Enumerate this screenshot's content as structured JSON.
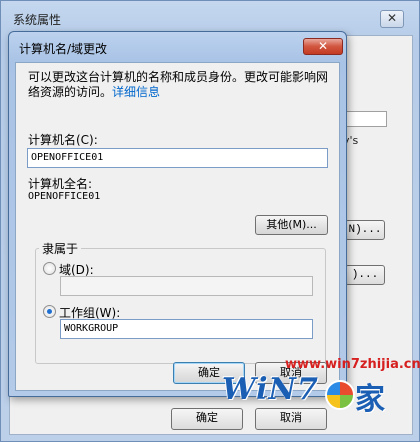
{
  "background_window": {
    "title": "系统属性",
    "close_glyph": "✕",
    "partial_text": "y's",
    "button_network": "N)...",
    "button_change": ")...",
    "ok_label": "确定",
    "cancel_label": "取消"
  },
  "dialog": {
    "title": "计算机名/域更改",
    "close_glyph": "✕",
    "description": "可以更改这台计算机的名称和成员身份。更改可能影响网络资源的访问。",
    "details_link": "详细信息",
    "computer_name_label": "计算机名(C):",
    "computer_name_value": "OPENOFFICE01",
    "full_name_label": "计算机全名:",
    "full_name_value": "OPENOFFICE01",
    "more_button": "其他(M)...",
    "member_of_label": "隶属于",
    "domain_label": "域(D):",
    "domain_value": "",
    "workgroup_label": "工作组(W):",
    "workgroup_value": "WORKGROUP",
    "membership_selected": "workgroup",
    "ok_label": "确定",
    "cancel_label": "取消"
  },
  "watermark": {
    "url": "www.win7zhijia.cn",
    "logo": "WiN7",
    "char": "家"
  },
  "colors": {
    "link": "#0066cc",
    "close_button": "#c43b23",
    "watermark_red": "#d62020",
    "watermark_blue": "#1b5fb4"
  }
}
